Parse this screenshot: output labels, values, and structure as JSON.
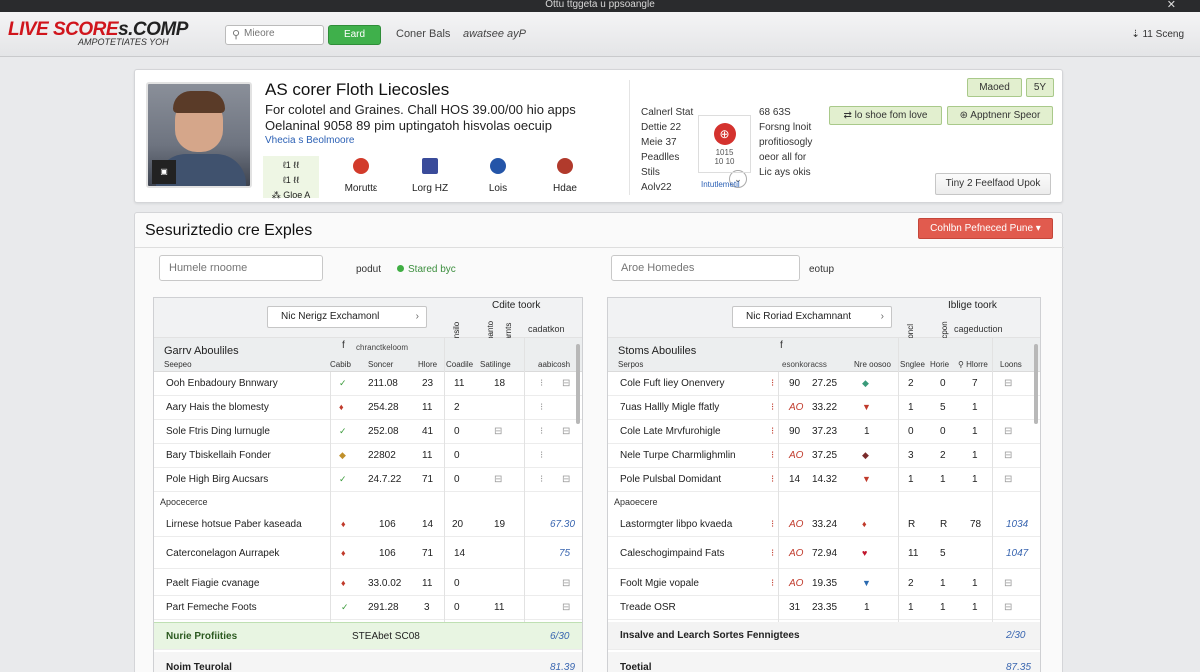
{
  "window": {
    "title": "Ottu ttggeta u ppsoangle"
  },
  "header": {
    "logo_main": "LIVE SCORE",
    "logo_tail": "s.COMP",
    "logo_sub": "AMPOTETIATES YOH",
    "search_placeholder": "Mieore",
    "search_button": "Eard",
    "nav": [
      "Coner Bals",
      "awatsee ayP"
    ],
    "settings": "⇣ 11 Sceng"
  },
  "profile": {
    "title": "AS corer Floth Liecosles",
    "desc_line1": "For colotel and Graines. Chall HOS 39.00/00 hio apps",
    "desc_line2": "Oelaninal 9058 89 pim uptingatoh hisvolas oecuip",
    "link": "Vhecia s Beolmoore",
    "teams": [
      {
        "label": "Moruttε",
        "color": "#d23b2b"
      },
      {
        "label": "Lorg HZ",
        "color": "#3a4b9a"
      },
      {
        "label": "Lois",
        "color": "#2455a8"
      },
      {
        "label": "Hdae",
        "color": "#b13a2c"
      }
    ],
    "first_team": {
      "l1": "ℓ1 ℓℓ",
      "l2": "ℓ1 ℓℓ",
      "l3": "⁂ Gloe A"
    },
    "stats_left": [
      "Calnerl Stat",
      "Dettie 22",
      "Meie 37",
      "Peadlles",
      "Stils",
      "Aolv22"
    ],
    "score_box": {
      "dot": "⊕",
      "l1": "1015",
      "l2": "10 10"
    },
    "score_link": "Intutlemetil",
    "stats_right": [
      "68 63S",
      "Forsng lnoit",
      "profitiosogly",
      "oeor all for",
      "Lic ays okis"
    ],
    "tags": [
      "Maoed",
      "5Y"
    ],
    "tag_buttons": [
      "⇄ lo shoe fom love",
      "⊛ Apptnenr Speor"
    ],
    "plain_button": "Tiny 2 Feelfaod Upok"
  },
  "section": {
    "title": "Sesuriztedio cre Exples",
    "red_button": "Cohlbn Pefneced Pune ▾",
    "left_input_placeholder": "Humele rnoome",
    "left_label": "podut",
    "left_status": "Stared byc",
    "right_input_placeholder": "Aroe Homedes",
    "right_label": "eotup"
  },
  "left_table": {
    "select": "Nic Nerigz Exchamonl",
    "top_label": "Cdite toork",
    "vertical_cols": [
      "Sansilo",
      "⊕",
      "Slpanto",
      "Clarnts"
    ],
    "sub_label": "cadatkon",
    "hdr_title": "Garrv Abouliles",
    "hdr_sub": "Seepeo",
    "fb": "f",
    "fb_sub": "chranctkeloom",
    "cols": [
      "Cabib",
      "Soncer",
      "Hlore",
      "Coadile",
      "Satilinge",
      "aabicosh"
    ],
    "rows": [
      [
        "Ooh Enbadoury Bnnwary",
        "✓",
        "211.08",
        "23",
        "11",
        "18",
        "⁝",
        "⊟"
      ],
      [
        "Aary Hais the blomesty",
        "♦",
        "254.28",
        "11",
        "2",
        "",
        "⁝",
        ""
      ],
      [
        "Sole Ftris Ding lurnugle",
        "✓",
        "252.08",
        "41",
        "0",
        "⊟",
        "⁝",
        "⊟"
      ],
      [
        "Bary Tbiskellaih Fonder",
        "◆",
        "22802",
        "11",
        "0",
        "",
        "⁝",
        ""
      ],
      [
        "Pole High Birg Aucsars",
        "✓",
        "24.7.22",
        "71",
        "0",
        "⊟",
        "⁝",
        "⊟"
      ]
    ],
    "category": "Apocecerce",
    "rows2": [
      [
        "Lirnese hotsue Paber kaseada",
        "♦",
        "106",
        "14",
        "20",
        "19",
        "",
        "67.30"
      ],
      [
        "Caterconelagon Aurrapek",
        "♦",
        "106",
        "71",
        "14",
        "",
        "",
        "75"
      ],
      [
        "Paelt Fiagie cvanage",
        "♦",
        "33.0.02",
        "11",
        "0",
        "",
        "",
        "⊟"
      ],
      [
        "Part Femeche Foots",
        "✓",
        "291.28",
        "3",
        "0",
        "11",
        "",
        "⊟"
      ]
    ],
    "highlight": [
      "Nurie Profiities",
      "STEAbet SC08",
      "6/30"
    ],
    "total": [
      "Noim Teurolal",
      "81.39"
    ]
  },
  "right_table": {
    "select": "Nic Roriad Exchamnant",
    "top_label": "Iblige toork",
    "vertical_cols": [
      "Soncl",
      "⊕",
      "Scpon"
    ],
    "sub_label": "cageduction",
    "hdr_title": "Stoms Abouliles",
    "hdr_sub": "Serpos",
    "fb": "f",
    "fb_sub": "esonkoracss",
    "cols": [
      "Nre oosoo",
      "Snglee",
      "Horie",
      "⚲ Hlorre",
      "Loons"
    ],
    "rows": [
      [
        "Cole Fuft liey Onenvery",
        "⁝",
        "90",
        "27.25",
        "◆",
        "2",
        "0",
        "7",
        "⊟"
      ],
      [
        "7uas Hallly Migle ffatly",
        "⁝",
        "AO",
        "33.22",
        "▼",
        "1",
        "5",
        "1",
        ""
      ],
      [
        "Cole Late Mrvfurohigle",
        "⁝",
        "90",
        "37.23",
        "1",
        "0",
        "0",
        "1",
        "⊟"
      ],
      [
        "Nele Turpe Charmlighmlin",
        "⁝",
        "AO",
        "37.25",
        "◆",
        "3",
        "2",
        "1",
        "⊟"
      ],
      [
        "Pole Pulsbal Domidant",
        "⁝",
        "14",
        "14.32",
        "▼",
        "1",
        "1",
        "1",
        "⊟"
      ]
    ],
    "category": "Apaoecere",
    "rows2": [
      [
        "Lastormgter libpo kvaeda",
        "⁝",
        "AO",
        "33.24",
        "♦",
        "R",
        "R",
        "78",
        "1034"
      ],
      [
        "Caleschogimpaind Fats",
        "⁝",
        "AO",
        "72.94",
        "♥",
        "11",
        "5",
        "",
        "1047"
      ],
      [
        "Foolt Mgie vopale",
        "⁝",
        "AO",
        "19.35",
        "▼",
        "2",
        "1",
        "1",
        "⊟"
      ],
      [
        "Treade OSR",
        "",
        "31",
        "23.35",
        "1",
        "1",
        "1",
        "1",
        "⊟"
      ]
    ],
    "highlight": [
      "Insalve and Learch Sortes Fennigtees",
      "2/30"
    ],
    "total": [
      "Toetial",
      "87.35"
    ]
  }
}
